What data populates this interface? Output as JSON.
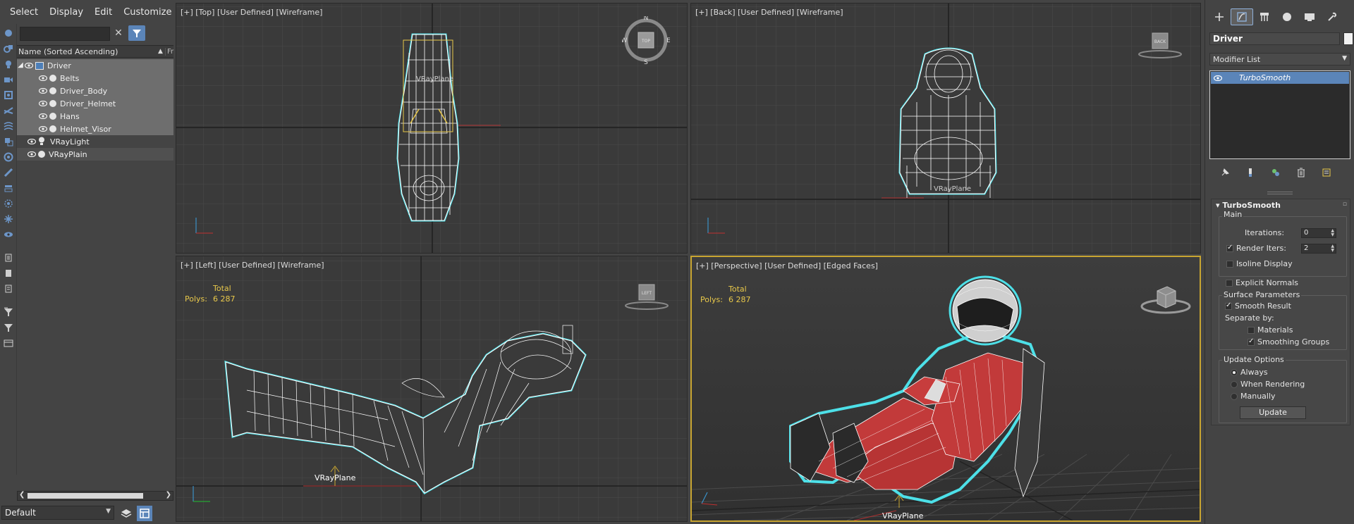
{
  "menu": {
    "select": "Select",
    "display": "Display",
    "edit": "Edit",
    "customize": "Customize"
  },
  "explorer": {
    "search_value": "",
    "clear_glyph": "✕",
    "sort_header": "Name (Sorted Ascending)",
    "sort_arrow": "▲",
    "sort_extra": "Fr",
    "items": [
      {
        "name": "Driver",
        "kind": "group",
        "expanded": true,
        "selected": true
      },
      {
        "name": "Belts",
        "kind": "mesh",
        "selected": true
      },
      {
        "name": "Driver_Body",
        "kind": "mesh",
        "selected": true
      },
      {
        "name": "Driver_Helmet",
        "kind": "mesh",
        "selected": true
      },
      {
        "name": "Hans",
        "kind": "mesh",
        "selected": true
      },
      {
        "name": "Helmet_Visor",
        "kind": "mesh",
        "selected": true
      },
      {
        "name": "VRayLight",
        "kind": "light",
        "selected": false
      },
      {
        "name": "VRayPlain",
        "kind": "mesh",
        "selected": false,
        "highlighted": true
      }
    ],
    "layer": "Default"
  },
  "viewports": {
    "top": {
      "label": "[+] [Top] [User Defined] [Wireframe]",
      "cube_face": "TOP",
      "compass": {
        "n": "N",
        "s": "S",
        "e": "E",
        "w": "W"
      },
      "obj_label": "VRayPlane"
    },
    "back": {
      "label": "[+] [Back] [User Defined] [Wireframe]",
      "cube_face": "BACK",
      "obj_label": "VRayPlane"
    },
    "left": {
      "label": "[+] [Left] [User Defined] [Wireframe]",
      "cube_face": "LEFT",
      "stats_total": "Total",
      "stats_polys_label": "Polys:",
      "stats_polys_value": "6 287",
      "obj_label": "VRayPlane"
    },
    "perspective": {
      "label": "[+] [Perspective] [User Defined] [Edged Faces]",
      "stats_total": "Total",
      "stats_polys_label": "Polys:",
      "stats_polys_value": "6 287",
      "obj_label": "VRayPlane"
    }
  },
  "command_panel": {
    "object_name": "Driver",
    "modifier_list": "Modifier List",
    "stack": [
      "TurboSmooth"
    ],
    "rollout": {
      "title": "TurboSmooth",
      "main": "Main",
      "iterations_label": "Iterations:",
      "iterations_value": "0",
      "render_iters_label": "Render Iters:",
      "render_iters_value": "2",
      "render_iters_checked": true,
      "isoline_label": "Isoline Display",
      "explicit_normals_label": "Explicit Normals",
      "surface_params": "Surface Parameters",
      "smooth_result_label": "Smooth Result",
      "separate_by": "Separate by:",
      "materials_label": "Materials",
      "smoothing_groups_label": "Smoothing Groups",
      "update_options": "Update Options",
      "always_label": "Always",
      "when_rendering_label": "When Rendering",
      "manually_label": "Manually",
      "update_button": "Update"
    }
  },
  "colors": {
    "selection_blue": "#5b85b9",
    "active_viewport": "#c8a531",
    "wire_cyan": "#4de0e8",
    "stat_yellow": "#e8c84a",
    "suit_red": "#c23a3a"
  }
}
